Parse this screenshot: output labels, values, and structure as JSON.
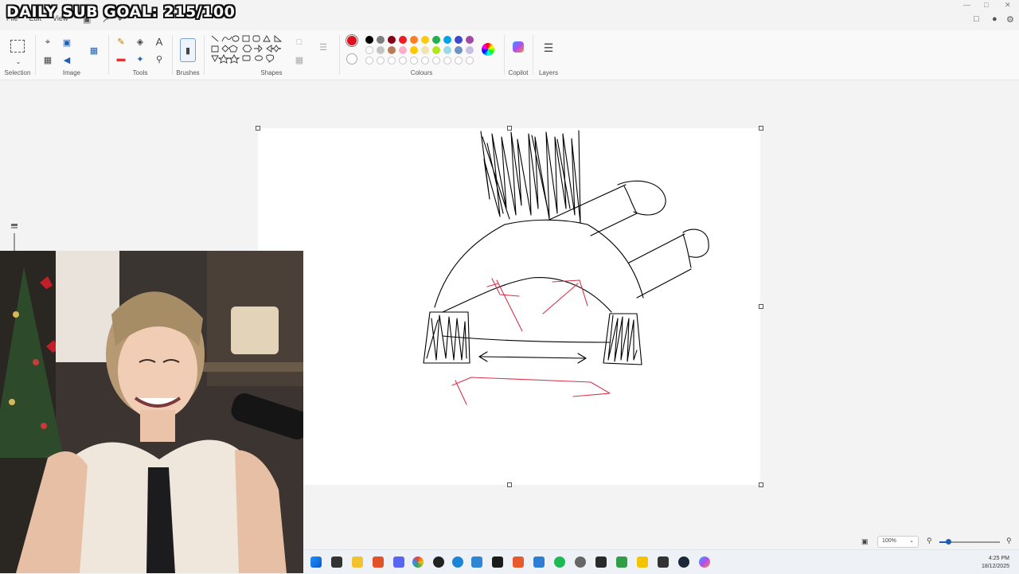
{
  "overlay": {
    "goal_text": "DAILY SUB GOAL: 215/100"
  },
  "menu": {
    "file": "File",
    "edit": "Edit",
    "view": "View"
  },
  "ribbon": {
    "selection_label": "Selection",
    "image_label": "Image",
    "tools_label": "Tools",
    "brushes_label": "Brushes",
    "shapes_label": "Shapes",
    "colours_label": "Colours",
    "copilot_label": "Copilot",
    "layers_label": "Layers",
    "text_tool_glyph": "A",
    "selected_colour": "#e0101f",
    "palette_row1": [
      "#000000",
      "#7f7f7f",
      "#880015",
      "#ed1c24",
      "#ff7f27",
      "#ffc90e",
      "#22b14c",
      "#00a2e8",
      "#3f48cc",
      "#a349a4"
    ],
    "palette_row2": [
      "#ffffff",
      "#c3c3c3",
      "#b97a57",
      "#ffaec9",
      "#ffc800",
      "#efe4b0",
      "#b5e61d",
      "#99d9ea",
      "#7092be",
      "#c8bfe7"
    ]
  },
  "status": {
    "zoom": "100%"
  },
  "taskbar": {
    "time": "4:25 PM",
    "date": "18/12/2025"
  }
}
